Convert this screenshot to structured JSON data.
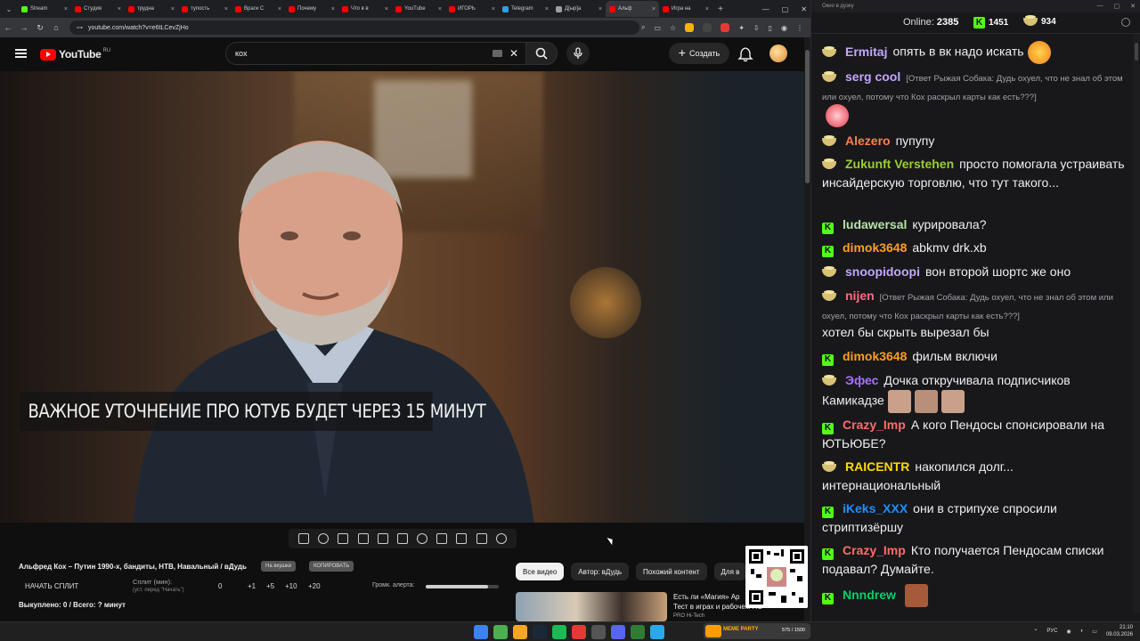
{
  "browser": {
    "tabs": [
      {
        "label": "Stream",
        "color": "#53fc18"
      },
      {
        "label": "Студия",
        "color": "#ff0000"
      },
      {
        "label": "трудна",
        "color": "#ff0000"
      },
      {
        "label": "тупость",
        "color": "#ff0000"
      },
      {
        "label": "Враги С",
        "color": "#ff0000"
      },
      {
        "label": "Почему",
        "color": "#ff0000"
      },
      {
        "label": "Что в в",
        "color": "#ff0000"
      },
      {
        "label": "YouTube",
        "color": "#ff0000"
      },
      {
        "label": "ИГОРЬ",
        "color": "#ff0000"
      },
      {
        "label": "Telegram",
        "color": "#2aa3e0"
      },
      {
        "label": "Д[ыр]а",
        "color": "#9e9e9e"
      },
      {
        "label": "Альф",
        "color": "#ff0000",
        "active": true
      },
      {
        "label": "Игра на",
        "color": "#ff0000"
      }
    ],
    "url": "youtube.com/watch?v=e6tLCevZjHo"
  },
  "youtube": {
    "logo_text": "YouTube",
    "logo_region": "RU",
    "search_value": "кох",
    "create_label": "Создать",
    "video_caption": "ВАЖНОЕ УТОЧНЕНИЕ ПРО ЮТУБ БУДЕТ ЧЕРЕЗ 15 МИНУТ",
    "video_title": "Альфред Кох – Путин 1990-х, бандиты, НТВ, Навальный / вДудь",
    "chip_1": "На вкушки",
    "chip_2": "КОПИРОВАТЬ",
    "split_button": "НАЧАТЬ СПЛИТ",
    "split_label": "Сплит (мин):",
    "split_sub": "(уст. перед \"Начать\")",
    "split_values": [
      "0",
      "+1",
      "+5",
      "+10",
      "+20"
    ],
    "alert_label": "Громк. алерта:",
    "alert_level": 0.85,
    "bought": "Выкуплено: 0 / Всего: ? минут",
    "filters": [
      "Все видео",
      "Автор: вДудь",
      "Похожий контент",
      "Для в"
    ],
    "rec_title": "Есть ли «Магия» Ар",
    "rec_title_2": "Тест в играх и рабочем ПО...",
    "rec_channel": "PRO Hi-Tech"
  },
  "chat": {
    "window_title": "Окно в дуэку",
    "online_label": "Online:",
    "online_count": "2385",
    "kick_count": "1451",
    "gold_count": "934",
    "messages": [
      {
        "user": "Ermitaj",
        "user_color": "#c3a6ff",
        "icon": "bowl",
        "text": "опять в вк надо искать"
      },
      {
        "user": "serg cool",
        "user_color": "#c3a6ff",
        "icon": "bowl",
        "reply": "[Ответ Рыжая Собака: Дудь охуел, что не знал об этом или охуел, потому что Кох раскрыл карты как есть???]",
        "text": ""
      },
      {
        "user": "Alezero",
        "user_color": "#ff7f50",
        "icon": "bowl",
        "text": "пупупу"
      },
      {
        "user": "Zukunft Verstehen",
        "user_color": "#9acd32",
        "icon": "bowl",
        "text": "просто помогала устраивать инсайдерскую торговлю, что тут такого..."
      },
      {
        "user": "ludawersal",
        "user_color": "#b7e3a4",
        "icon": "kick",
        "text": "курировала?"
      },
      {
        "user": "dimok3648",
        "user_color": "#ff9f1a",
        "icon": "kick",
        "text": "abkmv drk.xb"
      },
      {
        "user": "snoopidoopi",
        "user_color": "#c3a6ff",
        "icon": "bowl",
        "text": "вон второй шортс же оно"
      },
      {
        "user": "nijen",
        "user_color": "#ff6b81",
        "icon": "bowl",
        "reply": "[Ответ Рыжая Собака: Дудь охуел, что не знал об этом или охуел, потому что Кох раскрыл карты как есть???]",
        "text": "хотел бы скрыть вырезал бы"
      },
      {
        "user": "dimok3648",
        "user_color": "#ff9f1a",
        "icon": "kick",
        "text": "фильм включи"
      },
      {
        "user": "Эфес",
        "user_color": "#a970ff",
        "icon": "bowl",
        "text": "Дочка откручивала подписчиков Камикадзе"
      },
      {
        "user": "Crazy_Imp",
        "user_color": "#ff6b6b",
        "icon": "kick",
        "text": "А кого Пендосы спонсировали на ЮТЬЮБЕ?"
      },
      {
        "user": "RAICENTR",
        "user_color": "#ffd700",
        "icon": "bowl",
        "text": "накопился долг... интернациональный"
      },
      {
        "user": "iKeks_XXX",
        "user_color": "#1e90ff",
        "icon": "kick",
        "text": "они в стрипухе спросили стриптизёршу"
      },
      {
        "user": "Crazy_Imp",
        "user_color": "#ff6b6b",
        "icon": "kick",
        "text": "Кто получается Пендосам списки подавал? Думайте."
      },
      {
        "user": "Nnndrew",
        "user_color": "#00d26a",
        "icon": "kick",
        "text": ""
      }
    ]
  },
  "taskbar": {
    "game_label": "MEME PARTY",
    "game_count": "575 / 1500",
    "lang": "РУС",
    "time": "21:10",
    "date": "09.03.2026"
  }
}
